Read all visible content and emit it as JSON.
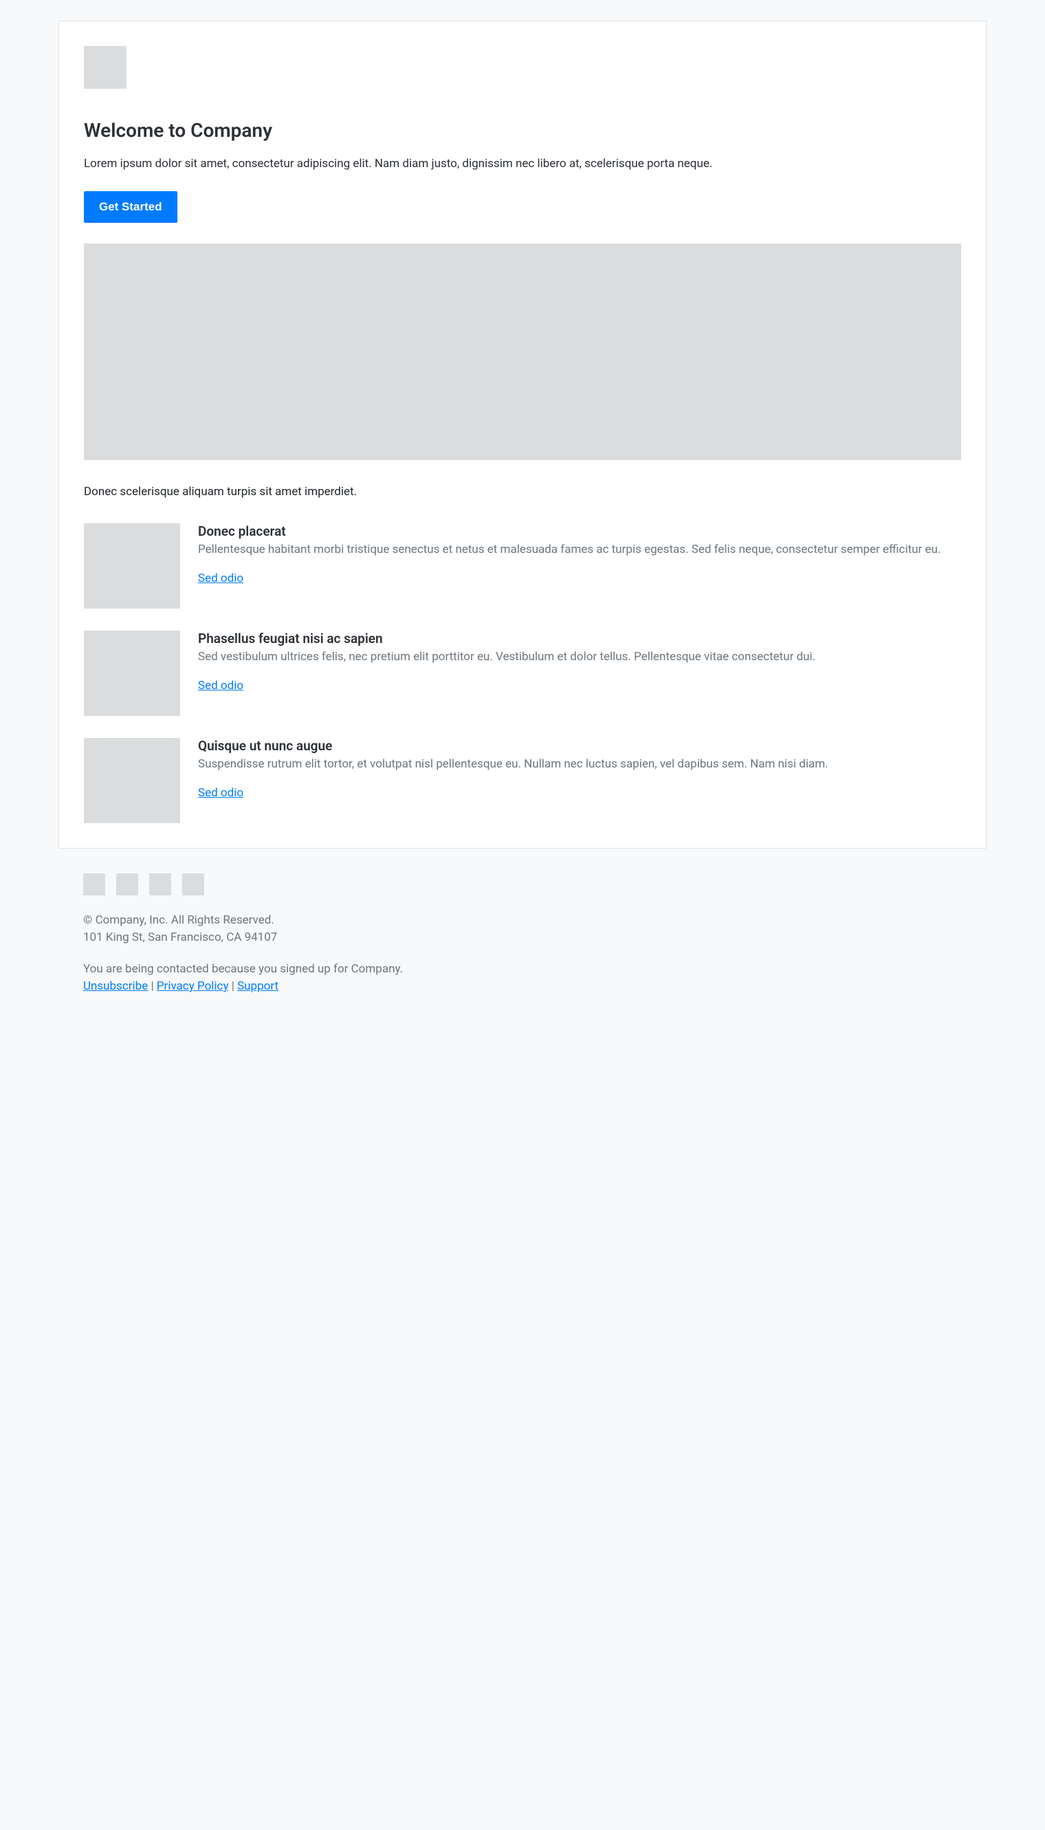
{
  "header": {
    "title": "Welcome to Company",
    "intro": "Lorem ipsum dolor sit amet, consectetur adipiscing elit. Nam diam justo, dignissim nec libero at, scelerisque porta neque.",
    "cta_label": "Get Started"
  },
  "body": {
    "sub_text": "Donec scelerisque aliquam turpis sit amet imperdiet."
  },
  "features": [
    {
      "title": "Donec placerat",
      "desc": "Pellentesque habitant morbi tristique senectus et netus et malesuada fames ac turpis egestas. Sed felis neque, consectetur semper efficitur eu.",
      "link": "Sed odio"
    },
    {
      "title": "Phasellus feugiat nisi ac sapien",
      "desc": "Sed vestibulum ultrices felis, nec pretium elit porttitor eu. Vestibulum et dolor tellus. Pellentesque vitae consectetur dui.",
      "link": "Sed odio"
    },
    {
      "title": "Quisque ut nunc augue",
      "desc": "Suspendisse rutrum elit tortor, et volutpat nisl pellentesque eu. Nullam nec luctus sapien, vel dapibus sem. Nam nisi diam.",
      "link": "Sed odio"
    }
  ],
  "footer": {
    "copyright": "© Company, Inc. All Rights Reserved.",
    "address": "101 King St, San Francisco, CA 94107",
    "contact_reason": "You are being contacted because you signed up for Company.",
    "unsubscribe": "Unsubscribe",
    "privacy": "Privacy Policy",
    "support": "Support",
    "sep": " | "
  }
}
